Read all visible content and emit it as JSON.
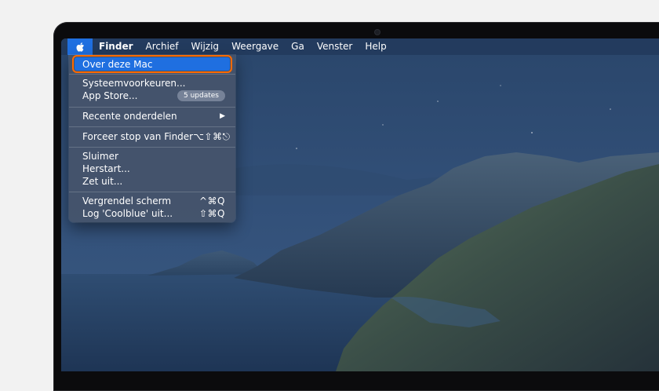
{
  "menubar": {
    "apple_icon": "apple-logo-icon",
    "app_name": "Finder",
    "items": [
      "Archief",
      "Wijzig",
      "Weergave",
      "Ga",
      "Venster",
      "Help"
    ]
  },
  "apple_menu": {
    "about": "Over deze Mac",
    "system_prefs": "Systeemvoorkeuren...",
    "app_store": "App Store...",
    "app_store_badge": "5 updates",
    "recent_items": "Recente onderdelen",
    "recent_items_arrow": "▶",
    "force_quit": "Forceer stop van Finder",
    "force_quit_shortcut": "⌥⇧⌘⎋",
    "sleep": "Sluimer",
    "restart": "Herstart...",
    "shut_down": "Zet uit...",
    "lock_screen": "Vergrendel scherm",
    "lock_screen_shortcut": "^⌘Q",
    "log_out": "Log 'Coolblue' uit...",
    "log_out_shortcut": "⇧⌘Q"
  },
  "colors": {
    "highlight": "#1f6fe0",
    "callout_outline": "#ff6a00",
    "menubar_bg": "#223a5c"
  }
}
